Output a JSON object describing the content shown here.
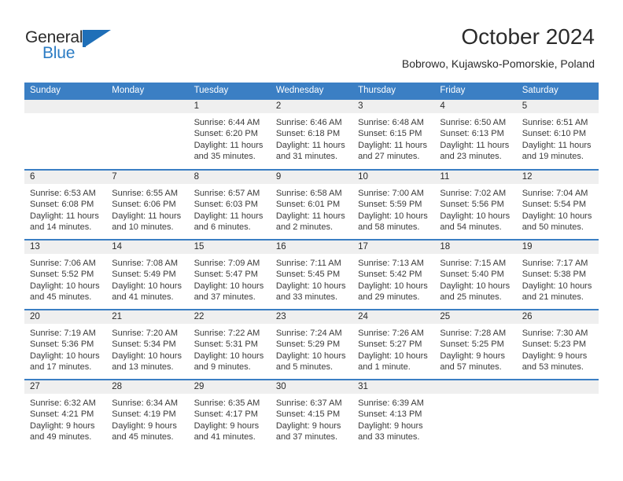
{
  "brand": {
    "name_part1": "General",
    "name_part2": "Blue",
    "flag_icon": "blue-flag-triangle",
    "accent_color": "#2b7cc4"
  },
  "header": {
    "title": "October 2024",
    "location": "Bobrowo, Kujawsko-Pomorskie, Poland"
  },
  "calendar": {
    "header_bg": "#3b7fc4",
    "header_text_color": "#ffffff",
    "date_band_bg": "#efefef",
    "row_separator_color": "#3b7fc4",
    "weekdays": [
      "Sunday",
      "Monday",
      "Tuesday",
      "Wednesday",
      "Thursday",
      "Friday",
      "Saturday"
    ],
    "weeks": [
      [
        {
          "day": "",
          "sunrise": "",
          "sunset": "",
          "daylight1": "",
          "daylight2": ""
        },
        {
          "day": "",
          "sunrise": "",
          "sunset": "",
          "daylight1": "",
          "daylight2": ""
        },
        {
          "day": "1",
          "sunrise": "Sunrise: 6:44 AM",
          "sunset": "Sunset: 6:20 PM",
          "daylight1": "Daylight: 11 hours",
          "daylight2": "and 35 minutes."
        },
        {
          "day": "2",
          "sunrise": "Sunrise: 6:46 AM",
          "sunset": "Sunset: 6:18 PM",
          "daylight1": "Daylight: 11 hours",
          "daylight2": "and 31 minutes."
        },
        {
          "day": "3",
          "sunrise": "Sunrise: 6:48 AM",
          "sunset": "Sunset: 6:15 PM",
          "daylight1": "Daylight: 11 hours",
          "daylight2": "and 27 minutes."
        },
        {
          "day": "4",
          "sunrise": "Sunrise: 6:50 AM",
          "sunset": "Sunset: 6:13 PM",
          "daylight1": "Daylight: 11 hours",
          "daylight2": "and 23 minutes."
        },
        {
          "day": "5",
          "sunrise": "Sunrise: 6:51 AM",
          "sunset": "Sunset: 6:10 PM",
          "daylight1": "Daylight: 11 hours",
          "daylight2": "and 19 minutes."
        }
      ],
      [
        {
          "day": "6",
          "sunrise": "Sunrise: 6:53 AM",
          "sunset": "Sunset: 6:08 PM",
          "daylight1": "Daylight: 11 hours",
          "daylight2": "and 14 minutes."
        },
        {
          "day": "7",
          "sunrise": "Sunrise: 6:55 AM",
          "sunset": "Sunset: 6:06 PM",
          "daylight1": "Daylight: 11 hours",
          "daylight2": "and 10 minutes."
        },
        {
          "day": "8",
          "sunrise": "Sunrise: 6:57 AM",
          "sunset": "Sunset: 6:03 PM",
          "daylight1": "Daylight: 11 hours",
          "daylight2": "and 6 minutes."
        },
        {
          "day": "9",
          "sunrise": "Sunrise: 6:58 AM",
          "sunset": "Sunset: 6:01 PM",
          "daylight1": "Daylight: 11 hours",
          "daylight2": "and 2 minutes."
        },
        {
          "day": "10",
          "sunrise": "Sunrise: 7:00 AM",
          "sunset": "Sunset: 5:59 PM",
          "daylight1": "Daylight: 10 hours",
          "daylight2": "and 58 minutes."
        },
        {
          "day": "11",
          "sunrise": "Sunrise: 7:02 AM",
          "sunset": "Sunset: 5:56 PM",
          "daylight1": "Daylight: 10 hours",
          "daylight2": "and 54 minutes."
        },
        {
          "day": "12",
          "sunrise": "Sunrise: 7:04 AM",
          "sunset": "Sunset: 5:54 PM",
          "daylight1": "Daylight: 10 hours",
          "daylight2": "and 50 minutes."
        }
      ],
      [
        {
          "day": "13",
          "sunrise": "Sunrise: 7:06 AM",
          "sunset": "Sunset: 5:52 PM",
          "daylight1": "Daylight: 10 hours",
          "daylight2": "and 45 minutes."
        },
        {
          "day": "14",
          "sunrise": "Sunrise: 7:08 AM",
          "sunset": "Sunset: 5:49 PM",
          "daylight1": "Daylight: 10 hours",
          "daylight2": "and 41 minutes."
        },
        {
          "day": "15",
          "sunrise": "Sunrise: 7:09 AM",
          "sunset": "Sunset: 5:47 PM",
          "daylight1": "Daylight: 10 hours",
          "daylight2": "and 37 minutes."
        },
        {
          "day": "16",
          "sunrise": "Sunrise: 7:11 AM",
          "sunset": "Sunset: 5:45 PM",
          "daylight1": "Daylight: 10 hours",
          "daylight2": "and 33 minutes."
        },
        {
          "day": "17",
          "sunrise": "Sunrise: 7:13 AM",
          "sunset": "Sunset: 5:42 PM",
          "daylight1": "Daylight: 10 hours",
          "daylight2": "and 29 minutes."
        },
        {
          "day": "18",
          "sunrise": "Sunrise: 7:15 AM",
          "sunset": "Sunset: 5:40 PM",
          "daylight1": "Daylight: 10 hours",
          "daylight2": "and 25 minutes."
        },
        {
          "day": "19",
          "sunrise": "Sunrise: 7:17 AM",
          "sunset": "Sunset: 5:38 PM",
          "daylight1": "Daylight: 10 hours",
          "daylight2": "and 21 minutes."
        }
      ],
      [
        {
          "day": "20",
          "sunrise": "Sunrise: 7:19 AM",
          "sunset": "Sunset: 5:36 PM",
          "daylight1": "Daylight: 10 hours",
          "daylight2": "and 17 minutes."
        },
        {
          "day": "21",
          "sunrise": "Sunrise: 7:20 AM",
          "sunset": "Sunset: 5:34 PM",
          "daylight1": "Daylight: 10 hours",
          "daylight2": "and 13 minutes."
        },
        {
          "day": "22",
          "sunrise": "Sunrise: 7:22 AM",
          "sunset": "Sunset: 5:31 PM",
          "daylight1": "Daylight: 10 hours",
          "daylight2": "and 9 minutes."
        },
        {
          "day": "23",
          "sunrise": "Sunrise: 7:24 AM",
          "sunset": "Sunset: 5:29 PM",
          "daylight1": "Daylight: 10 hours",
          "daylight2": "and 5 minutes."
        },
        {
          "day": "24",
          "sunrise": "Sunrise: 7:26 AM",
          "sunset": "Sunset: 5:27 PM",
          "daylight1": "Daylight: 10 hours",
          "daylight2": "and 1 minute."
        },
        {
          "day": "25",
          "sunrise": "Sunrise: 7:28 AM",
          "sunset": "Sunset: 5:25 PM",
          "daylight1": "Daylight: 9 hours",
          "daylight2": "and 57 minutes."
        },
        {
          "day": "26",
          "sunrise": "Sunrise: 7:30 AM",
          "sunset": "Sunset: 5:23 PM",
          "daylight1": "Daylight: 9 hours",
          "daylight2": "and 53 minutes."
        }
      ],
      [
        {
          "day": "27",
          "sunrise": "Sunrise: 6:32 AM",
          "sunset": "Sunset: 4:21 PM",
          "daylight1": "Daylight: 9 hours",
          "daylight2": "and 49 minutes."
        },
        {
          "day": "28",
          "sunrise": "Sunrise: 6:34 AM",
          "sunset": "Sunset: 4:19 PM",
          "daylight1": "Daylight: 9 hours",
          "daylight2": "and 45 minutes."
        },
        {
          "day": "29",
          "sunrise": "Sunrise: 6:35 AM",
          "sunset": "Sunset: 4:17 PM",
          "daylight1": "Daylight: 9 hours",
          "daylight2": "and 41 minutes."
        },
        {
          "day": "30",
          "sunrise": "Sunrise: 6:37 AM",
          "sunset": "Sunset: 4:15 PM",
          "daylight1": "Daylight: 9 hours",
          "daylight2": "and 37 minutes."
        },
        {
          "day": "31",
          "sunrise": "Sunrise: 6:39 AM",
          "sunset": "Sunset: 4:13 PM",
          "daylight1": "Daylight: 9 hours",
          "daylight2": "and 33 minutes."
        },
        {
          "day": "",
          "sunrise": "",
          "sunset": "",
          "daylight1": "",
          "daylight2": ""
        },
        {
          "day": "",
          "sunrise": "",
          "sunset": "",
          "daylight1": "",
          "daylight2": ""
        }
      ]
    ]
  }
}
